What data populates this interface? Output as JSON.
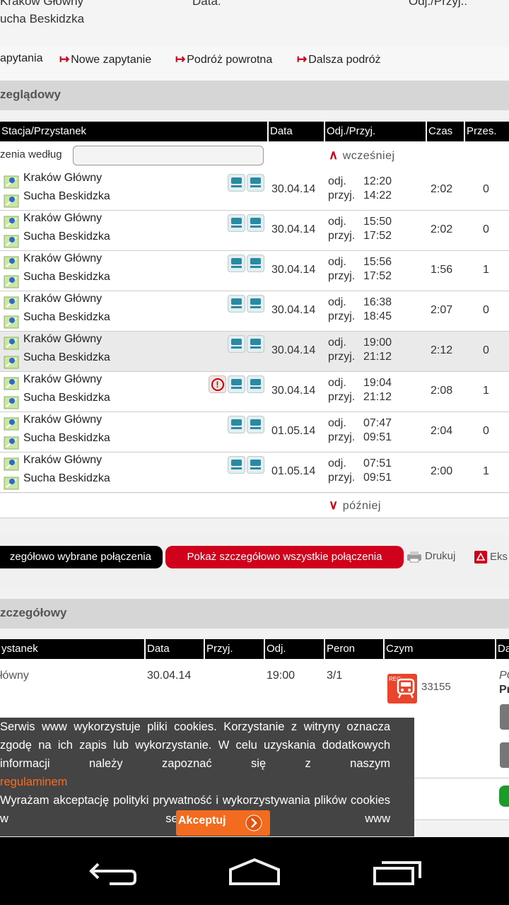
{
  "summary": {
    "row1_left": "Kraków Główny",
    "row1_mid": "Data:",
    "row1_right": "Odj./Przyj.:",
    "destination": "ucha Beskidzka"
  },
  "links": {
    "first": "apytania",
    "new_query": "Nowe zapytanie",
    "return_trip": "Podróż powrotna",
    "continue_trip": "Dalsza podróż"
  },
  "overview": {
    "section_title": "zeglądowy",
    "columns": [
      "Stacja/Przystanek",
      "Data",
      "Odj./Przyj.",
      "Czas",
      "Przes."
    ],
    "filter_label": "zenia według",
    "earlier": "wcześniej",
    "later": "później",
    "labels": {
      "dep": "odj.",
      "arr": "przyj."
    },
    "rows": [
      {
        "from": "Kraków Główny",
        "to": "Sucha Beskidzka",
        "date": "30.04.14",
        "dep": "12:20",
        "arr": "14:22",
        "dur": "2:02",
        "changes": "0",
        "warning": false
      },
      {
        "from": "Kraków Główny",
        "to": "Sucha Beskidzka",
        "date": "30.04.14",
        "dep": "15:50",
        "arr": "17:52",
        "dur": "2:02",
        "changes": "0",
        "warning": false
      },
      {
        "from": "Kraków Główny",
        "to": "Sucha Beskidzka",
        "date": "30.04.14",
        "dep": "15:56",
        "arr": "17:52",
        "dur": "1:56",
        "changes": "1",
        "warning": false
      },
      {
        "from": "Kraków Główny",
        "to": "Sucha Beskidzka",
        "date": "30.04.14",
        "dep": "16:38",
        "arr": "18:45",
        "dur": "2:07",
        "changes": "0",
        "warning": false
      },
      {
        "from": "Kraków Główny",
        "to": "Sucha Beskidzka",
        "date": "30.04.14",
        "dep": "19:00",
        "arr": "21:12",
        "dur": "2:12",
        "changes": "0",
        "warning": false
      },
      {
        "from": "Kraków Główny",
        "to": "Sucha Beskidzka",
        "date": "30.04.14",
        "dep": "19:04",
        "arr": "21:12",
        "dur": "2:08",
        "changes": "1",
        "warning": true
      },
      {
        "from": "Kraków Główny",
        "to": "Sucha Beskidzka",
        "date": "01.05.14",
        "dep": "07:47",
        "arr": "09:51",
        "dur": "2:04",
        "changes": "0",
        "warning": false
      },
      {
        "from": "Kraków Główny",
        "to": "Sucha Beskidzka",
        "date": "01.05.14",
        "dep": "07:51",
        "arr": "09:51",
        "dur": "2:00",
        "changes": "1",
        "warning": false
      }
    ]
  },
  "actions": {
    "show_selected": "zegółowo wybrane połączenia",
    "show_all": "Pokaż szczegółowo wszystkie połączenia",
    "print": "Drukuj",
    "export": "Eks"
  },
  "detail": {
    "section_title": "zczegółowy",
    "columns": [
      "ystanek",
      "Data",
      "Przyj.",
      "Odj.",
      "Peron",
      "Czym",
      "Da"
    ],
    "row": {
      "station": "łówny",
      "date": "30.04.14",
      "arr": "",
      "dep": "19:00",
      "platform": "3/1",
      "train": "33155",
      "remark1": "PO",
      "remark2": "Pr"
    },
    "reg_label": "REG"
  },
  "cookie": {
    "text": "Serwis www wykorzystuje pliki cookies. Korzystanie z witryny oznacza zgodę na ich zapis lub wykorzystanie. W celu uzyskania dodatkowych informacji należy zapoznać się z naszym",
    "link": "regulaminem",
    "consent": "Wyrażam akceptację polityki prywatność i wykorzystywania plików cookies w serwisie www",
    "accept": "Akceptuj"
  },
  "colors": {
    "accent": "#d0021b",
    "cookie_bg": "#444444",
    "accept": "#f26b1f"
  }
}
